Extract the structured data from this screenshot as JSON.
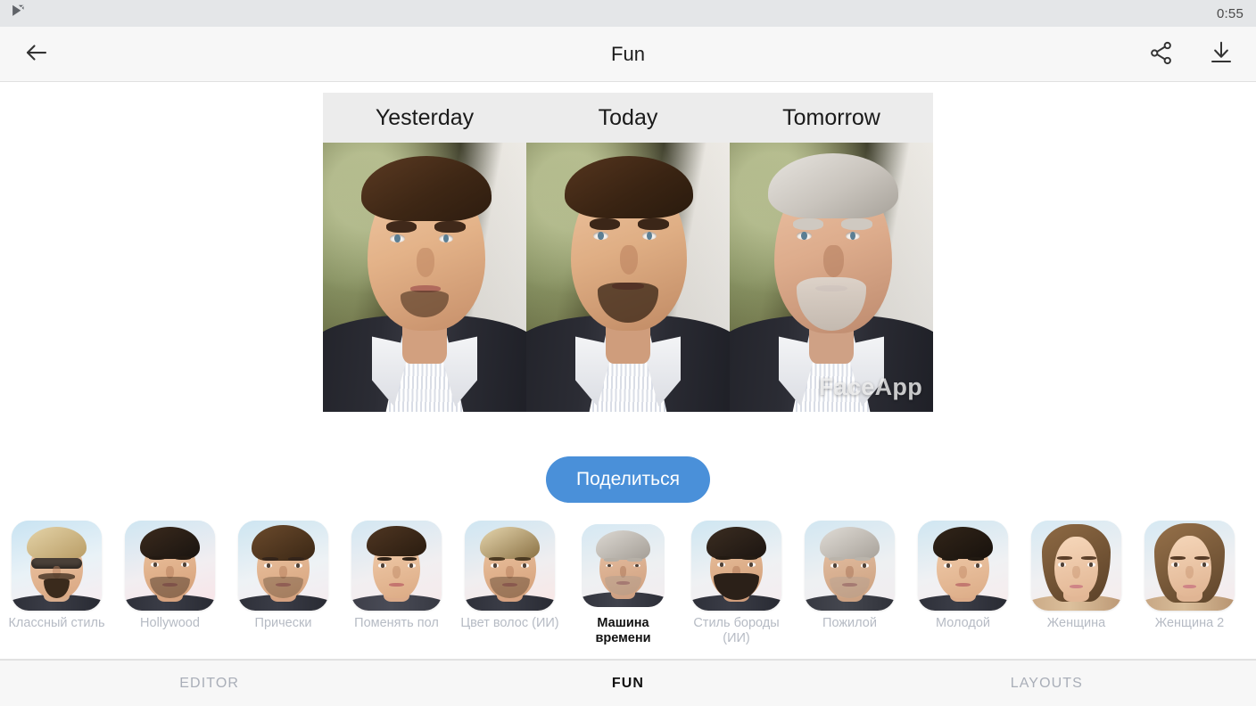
{
  "status_bar": {
    "notification_icon": "play-check-icon",
    "time": "0:55"
  },
  "toolbar": {
    "back_icon": "arrow-left-icon",
    "title": "Fun",
    "share_icon": "share-icon",
    "download_icon": "download-icon"
  },
  "collage": {
    "columns": [
      {
        "label": "Yesterday"
      },
      {
        "label": "Today"
      },
      {
        "label": "Tomorrow"
      }
    ],
    "watermark": "FaceApp"
  },
  "share_button": {
    "label": "Поделиться"
  },
  "filters": [
    {
      "label": "Классный стиль",
      "selected": false
    },
    {
      "label": "Hollywood",
      "selected": false
    },
    {
      "label": "Прически",
      "selected": false
    },
    {
      "label": "Поменять пол",
      "selected": false
    },
    {
      "label": "Цвет волос (ИИ)",
      "selected": false
    },
    {
      "label": "Машина времени",
      "selected": true
    },
    {
      "label": "Стиль бороды (ИИ)",
      "selected": false
    },
    {
      "label": "Пожилой",
      "selected": false
    },
    {
      "label": "Молодой",
      "selected": false
    },
    {
      "label": "Женщина",
      "selected": false
    },
    {
      "label": "Женщина 2",
      "selected": false
    }
  ],
  "tabs": [
    {
      "label": "EDITOR",
      "active": false
    },
    {
      "label": "FUN",
      "active": true
    },
    {
      "label": "LAYOUTS",
      "active": false
    }
  ],
  "colors": {
    "accent": "#4a90d9",
    "status_bar_bg": "#e4e6e8",
    "toolbar_bg": "#f7f7f7",
    "collage_header_bg": "#ececec",
    "label_inactive": "#b6bbc4",
    "label_active": "#111111"
  }
}
